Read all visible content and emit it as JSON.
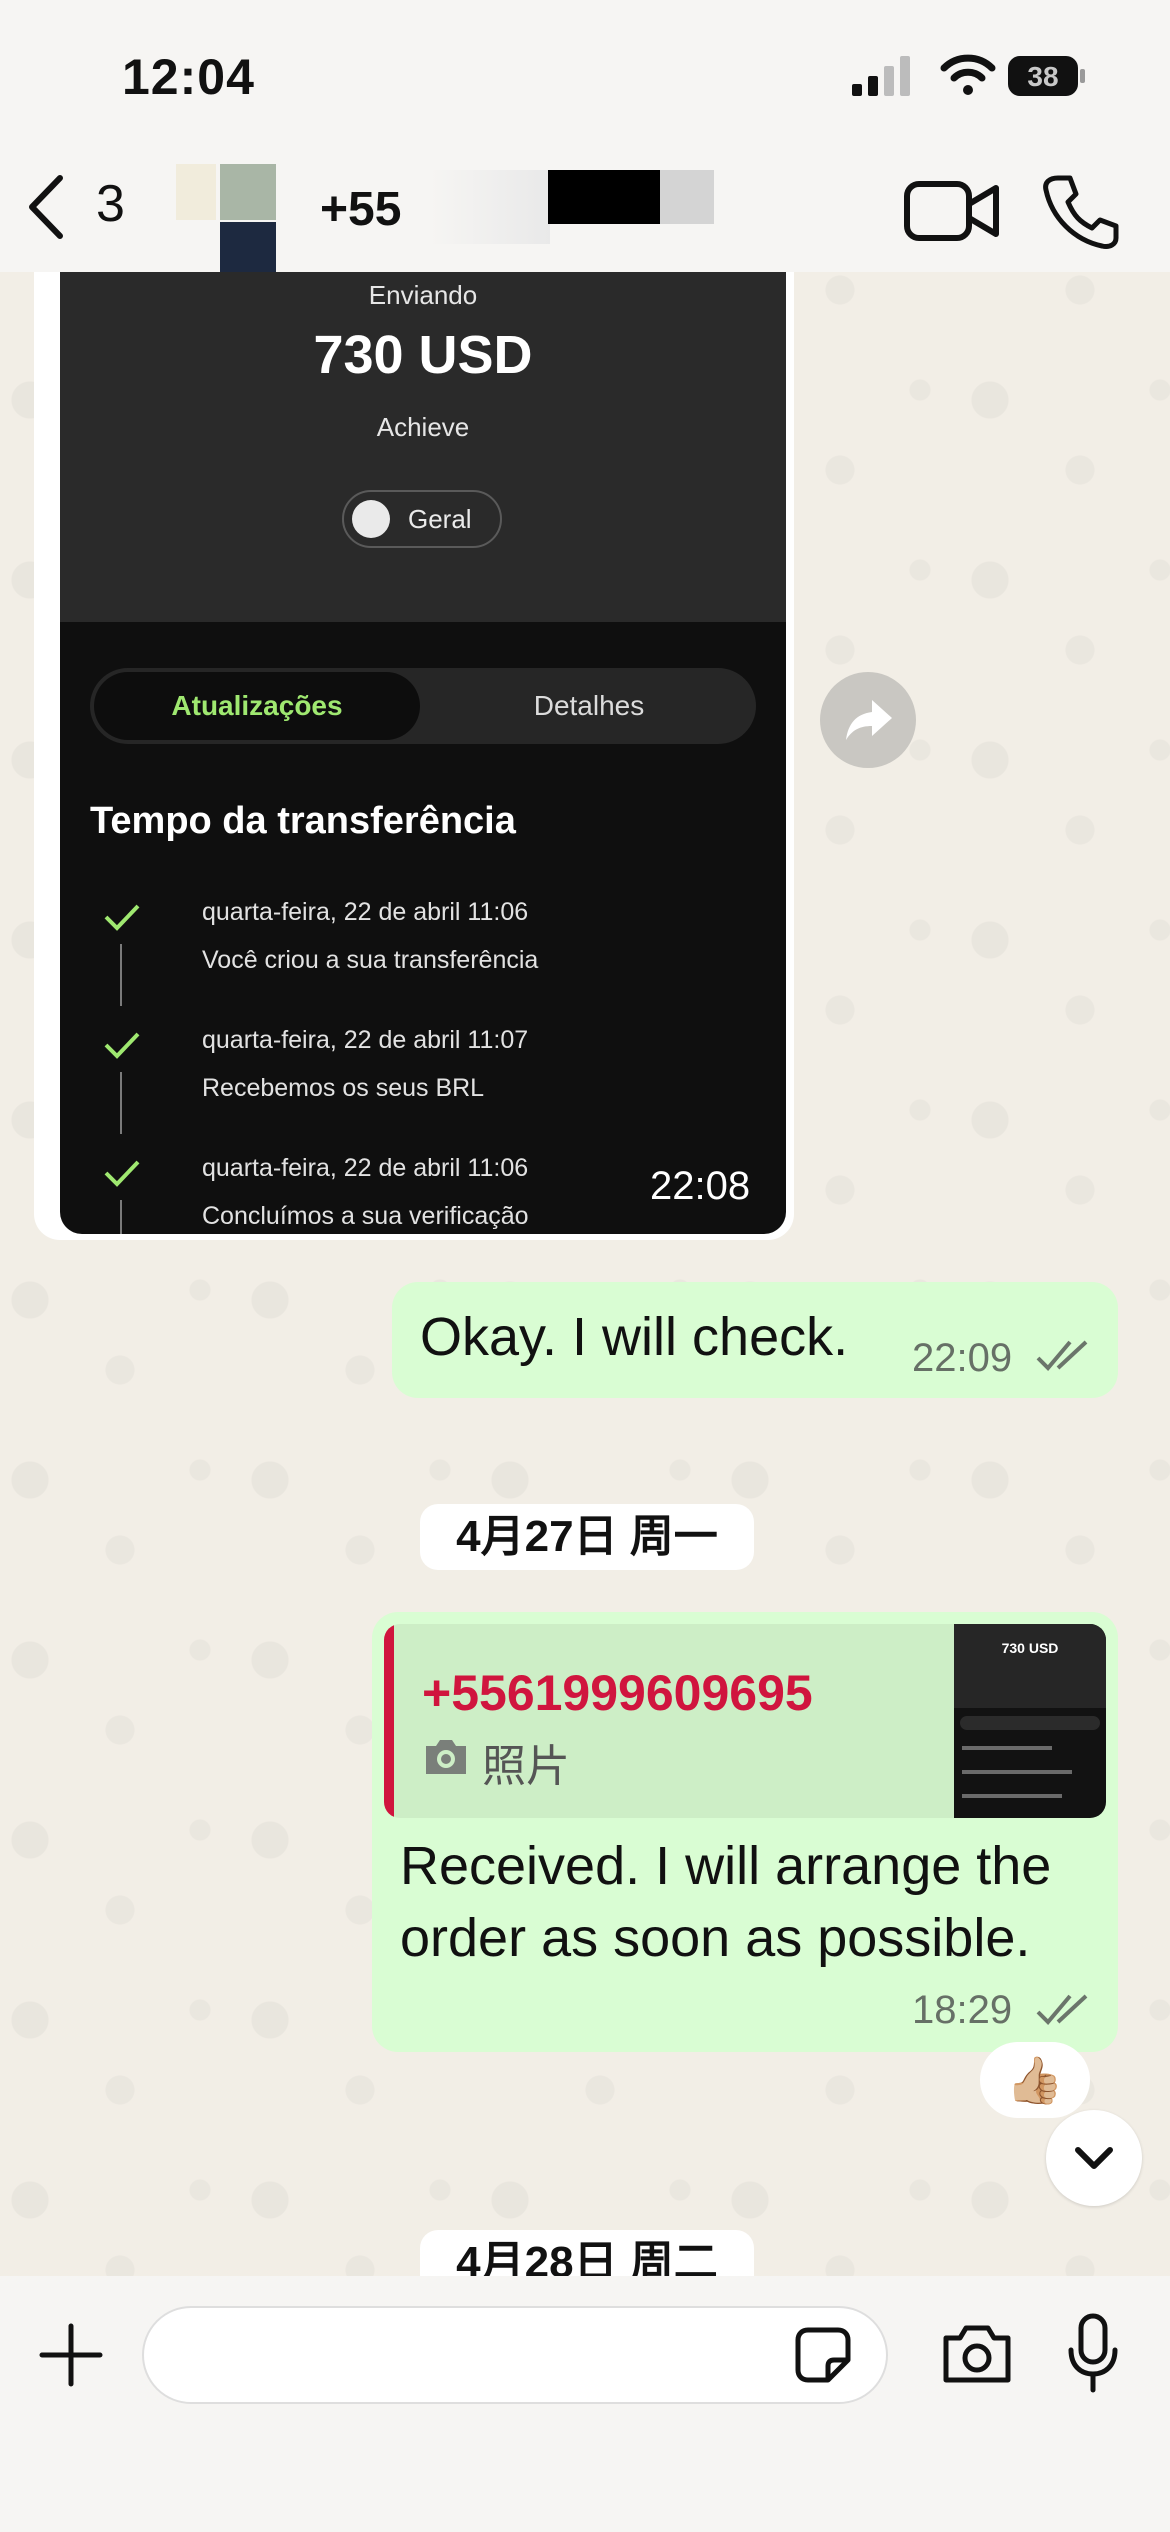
{
  "status_bar": {
    "time": "12:04",
    "battery": "38"
  },
  "header": {
    "back_count": "3",
    "contact_name": "+55"
  },
  "image_message": {
    "enviando": "Enviando",
    "amount": "730 USD",
    "recipient": "Achieve",
    "chip": "Geral",
    "tabs": [
      "Atualizações",
      "Detalhes"
    ],
    "timeline_title": "Tempo da transferência",
    "timeline": [
      {
        "date": "quarta-feira, 22 de abril 11:06",
        "text": "Você criou a sua transferência"
      },
      {
        "date": "quarta-feira, 22 de abril 11:07",
        "text": "Recebemos os seus BRL"
      },
      {
        "date": "quarta-feira, 22 de abril 11:06",
        "text": "Concluímos a sua verificação"
      }
    ],
    "time": "22:08"
  },
  "messages": [
    {
      "text": "Okay. I will check.",
      "time": "22:09"
    }
  ],
  "date_separators": [
    "4月27日 周一",
    "4月28日 周二"
  ],
  "reply_message": {
    "quoted_sender": "+5561999609695",
    "quoted_type": "照片",
    "thumb_amount": "730 USD",
    "text": "Received. I will arrange the order as soon as possible.",
    "time": "18:29",
    "reaction": "👍🏼"
  },
  "colors": {
    "outgoing_bubble": "#d9fdd3",
    "quote_accent": "#d0153e",
    "wise_green": "#9fe870"
  }
}
